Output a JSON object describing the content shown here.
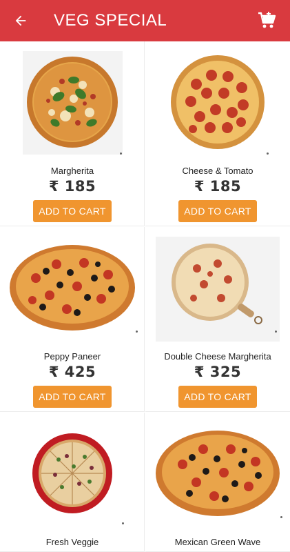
{
  "header": {
    "title": "VEG SPECIAL",
    "back_icon": "arrow-left-icon",
    "cart_icon": "shopping-cart-icon",
    "bar_color": "#d93a3f"
  },
  "accent_color": "#f0952f",
  "products": [
    {
      "name": "Margherita",
      "price": "₹ 185",
      "button": "ADD TO CART",
      "pizza_style": "margherita"
    },
    {
      "name": "Cheese & Tomato",
      "price": "₹ 185",
      "button": "ADD TO CART",
      "pizza_style": "pepperoni"
    },
    {
      "name": "Peppy Paneer",
      "price": "₹ 425",
      "button": "ADD TO CART",
      "pizza_style": "olive-pepper"
    },
    {
      "name": "Double Cheese Margherita",
      "price": "₹ 325",
      "button": "ADD TO CART",
      "pizza_style": "board"
    },
    {
      "name": "Fresh Veggie",
      "price": "",
      "button": "",
      "pizza_style": "veggie-plate"
    },
    {
      "name": "Mexican Green Wave",
      "price": "",
      "button": "",
      "pizza_style": "olive-pepper"
    }
  ]
}
